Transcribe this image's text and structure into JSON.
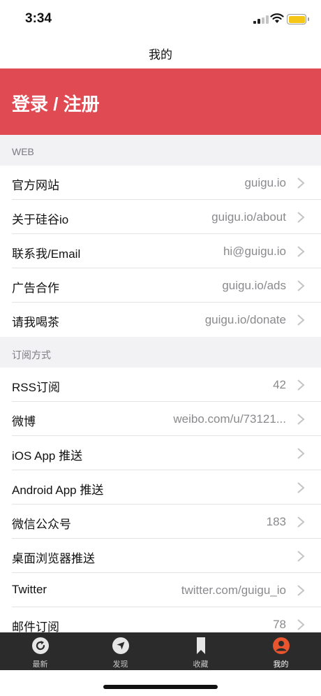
{
  "status_bar": {
    "time": "3:34"
  },
  "nav": {
    "title": "我的"
  },
  "login": {
    "label": "登录 / 注册"
  },
  "sections": [
    {
      "header": "WEB",
      "rows": [
        {
          "label": "官方网站",
          "value": "guigu.io"
        },
        {
          "label": "关于硅谷io",
          "value": "guigu.io/about"
        },
        {
          "label": "联系我/Email",
          "value": "hi@guigu.io"
        },
        {
          "label": "广告合作",
          "value": "guigu.io/ads"
        },
        {
          "label": "请我喝茶",
          "value": "guigu.io/donate"
        }
      ]
    },
    {
      "header": "订阅方式",
      "rows": [
        {
          "label": "RSS订阅",
          "value": "42"
        },
        {
          "label": "微博",
          "value": "weibo.com/u/73121..."
        },
        {
          "label": "iOS App 推送",
          "value": ""
        },
        {
          "label": "Android App 推送",
          "value": ""
        },
        {
          "label": "微信公众号",
          "value": "183"
        },
        {
          "label": "桌面浏览器推送",
          "value": ""
        },
        {
          "label": "Twitter",
          "value": "twitter.com/guigu_io"
        },
        {
          "label": "邮件订阅",
          "value": "78"
        }
      ]
    }
  ],
  "tab_bar": {
    "tabs": [
      {
        "label": "最新",
        "icon": "refresh-icon"
      },
      {
        "label": "发现",
        "icon": "compass-icon"
      },
      {
        "label": "收藏",
        "icon": "bookmark-icon"
      },
      {
        "label": "我的",
        "icon": "profile-icon",
        "active": true
      }
    ]
  },
  "colors": {
    "accent": "#e04a53",
    "active_tab": "#e8552f",
    "tab_bar": "#2b2b2b"
  }
}
